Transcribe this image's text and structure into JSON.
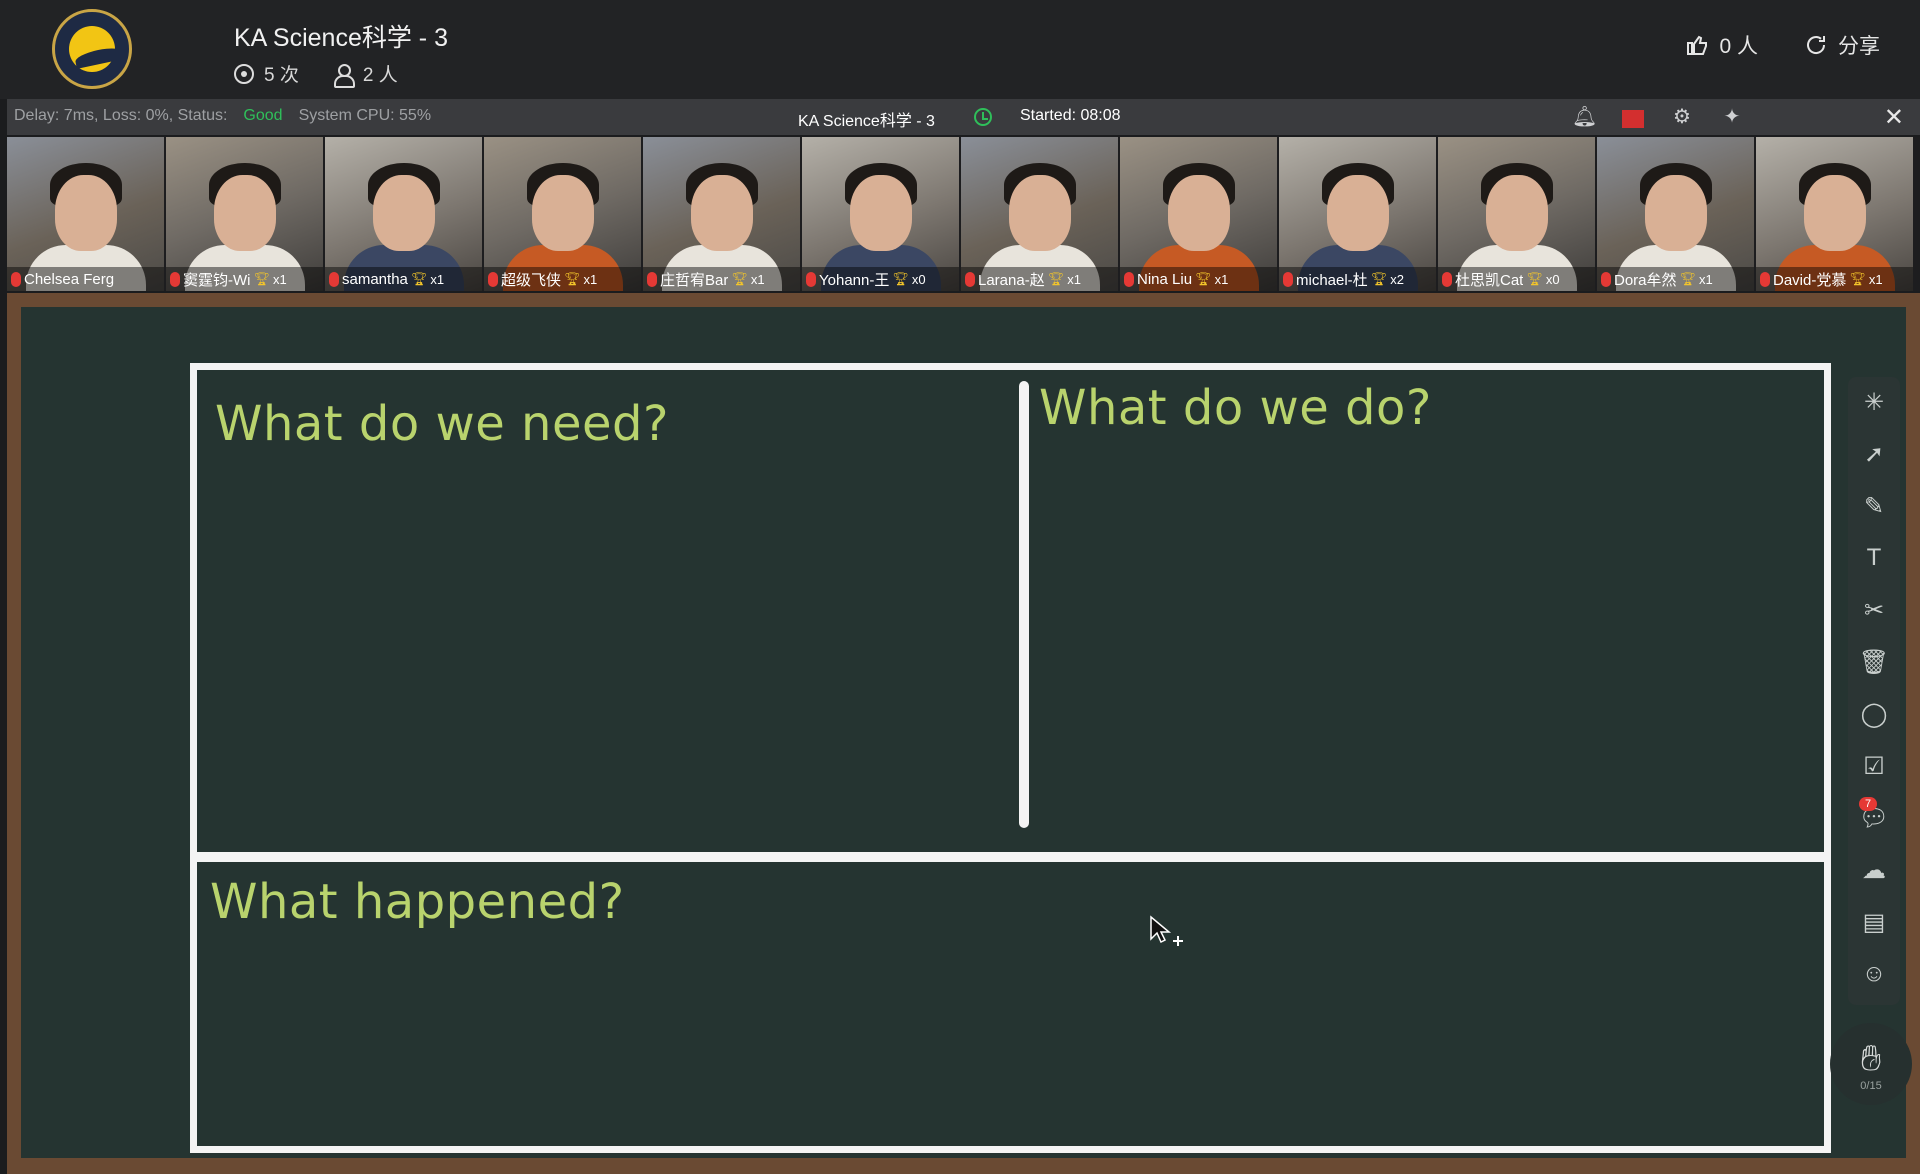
{
  "header": {
    "course_title": "KA Science科学 - 3",
    "views": "5 次",
    "attendees": "2 人",
    "likes": "0 人",
    "share_label": "分享"
  },
  "statusbar": {
    "delay": "Delay: 7ms, Loss: 0%, Status:",
    "status": "Good",
    "cpu": "System CPU: 55%",
    "room_title": "KA Science科学 - 3",
    "started": "Started: 08:08",
    "status_color": "#2fbf5a"
  },
  "participants": [
    {
      "name": "Chelsea Ferg",
      "count": ""
    },
    {
      "name": "窦霆钧-Wi",
      "count": "x1"
    },
    {
      "name": "samantha",
      "count": "x1"
    },
    {
      "name": "超级飞侠",
      "count": "x1"
    },
    {
      "name": "庄哲宥Bar",
      "count": "x1"
    },
    {
      "name": "Yohann-王",
      "count": "x0"
    },
    {
      "name": "Larana-赵",
      "count": "x1"
    },
    {
      "name": "Nina Liu",
      "count": "x1"
    },
    {
      "name": "michael-杜",
      "count": "x2"
    },
    {
      "name": "杜思凯Cat",
      "count": "x0"
    },
    {
      "name": "Dora牟然",
      "count": "x1"
    },
    {
      "name": "David-党慕",
      "count": "x1"
    }
  ],
  "board": {
    "q1": "What do we need?",
    "q2": "What do we do?",
    "q3": "What happened?"
  },
  "toolbar": {
    "chat_badge": "7",
    "raise_hand_count": "0/15"
  },
  "colors": {
    "board_bg": "#253431",
    "chalk_text": "#b9d36d",
    "frame": "#6a4a33"
  }
}
